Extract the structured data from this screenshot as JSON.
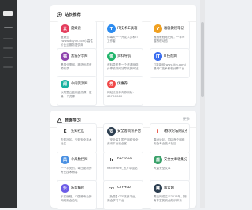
{
  "site_section": {
    "title": "站长推荐",
    "items": [
      {
        "name": "度娘云",
        "desc": "度娘云(www.dnyun.com)-高性价比云服务提供商",
        "icon": "cloud-icon",
        "color": "#e43c5c",
        "glyph": "云"
      },
      {
        "name": "IT技术工具箱",
        "desc": "你每天一个开发人员和IT工作者",
        "icon": "toolbox-icon",
        "color": "#2d8cf0",
        "glyph": "T"
      },
      {
        "name": "雅雅教程笔记",
        "desc": "雅雅教程笔记网，一手掌握教程动态",
        "icon": "notes-icon",
        "color": "#f0a020",
        "glyph": "Y"
      },
      {
        "name": "黑猫分享网",
        "desc": "黑猫分享网，精选优质资源收录",
        "icon": "cat-icon",
        "color": "#8e44ad",
        "glyph": "猫"
      },
      {
        "name": "资料导航",
        "desc": "资料导航是一个资源网络分享收录网站导航的网站",
        "icon": "compass-icon",
        "color": "#20b46a",
        "glyph": "资"
      },
      {
        "name": "IT技能网",
        "desc": "IT技能网(www.itjn.com)是网IT技术教程分享平台",
        "icon": "cpu-icon",
        "color": "#3a6df0",
        "glyph": "IT"
      },
      {
        "name": "小阔资源网",
        "desc": "以阿里云盘网盘资源，做最一个资源",
        "icon": "folder-icon",
        "color": "#19b2a0",
        "glyph": "阔"
      },
      {
        "name": "优惠券",
        "desc": "网站优惠券淘券网站：687D0D80",
        "icon": "coupon-icon",
        "color": "#f04848",
        "glyph": "券"
      }
    ]
  },
  "learn_section": {
    "title": "竞客学习",
    "more": "更多",
    "items": [
      {
        "name": "先知社区",
        "desc": "先知社区，先知安全技术社区",
        "icon": "xianzhi-icon",
        "color": "#ffffff",
        "glyph": "K"
      },
      {
        "name": "安全客资讯平台",
        "desc": "【安全客】国产网络安全资讯平台安全客",
        "icon": "anquanke-icon",
        "color": "#2c3e50",
        "glyph": "安"
      },
      {
        "name": "i春秋论坛网友社区",
        "desc": "春秋论坛，国内首个网络安全专业技术社区",
        "icon": "ichunqiu-icon",
        "color": "#ffffff",
        "glyph": "i"
      },
      {
        "name": "小风数控网",
        "desc": "一个平安的，每日更新的专业技术博客",
        "icon": "wind-icon",
        "color": "#4a90e2",
        "glyph": "风"
      },
      {
        "name": "hackone",
        "desc": "hackerone_官方中国站",
        "icon": "hackerone-icon",
        "color": "#ffffff",
        "glyph": "h"
      },
      {
        "name": "安全文章收集分享",
        "desc": "大量安全文章",
        "icon": "shield-icon",
        "color": "#3aa16a",
        "glyph": "盾"
      },
      {
        "name": "乐客编程",
        "desc": "乐客编程，中国最专业的网络安全论坛",
        "icon": "leke-icon",
        "color": "#6c5ce7",
        "glyph": "乐"
      },
      {
        "name": "CTFHub",
        "desc": "【免费】CTF挑战平台，安全学习平台",
        "icon": "ctfhub-icon",
        "color": "#ffffff",
        "glyph": "CTF"
      },
      {
        "name": "鹰云网",
        "desc": "鹰云网成立于2016年，拥有丰富的安全知识体系",
        "icon": "eagle-icon",
        "color": "#2c3e50",
        "glyph": "鹰"
      }
    ]
  }
}
